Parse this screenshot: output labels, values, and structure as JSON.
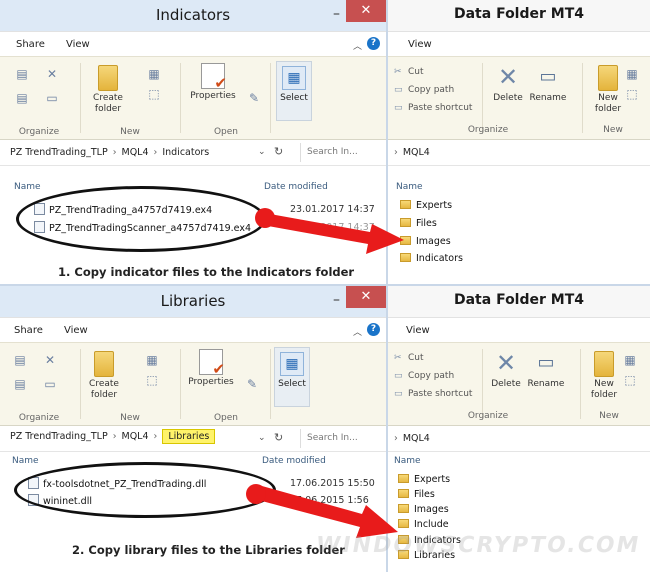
{
  "top_left": {
    "title": "Indicators",
    "tabs": [
      "Share",
      "View"
    ],
    "groups": {
      "organize": "Organize",
      "new": "New",
      "open": "Open"
    },
    "new_folder": "Create\nfolder",
    "properties": "Properties",
    "select": "Select",
    "path": [
      "PZ TrendTrading_TLP",
      "MQL4",
      "Indicators"
    ],
    "search_placeholder": "Search In...",
    "col_name": "Name",
    "col_date": "Date modified",
    "files": [
      {
        "name": "PZ_TrendTrading_a4757d7419.ex4",
        "date": "23.01.2017 14:37"
      },
      {
        "name": "PZ_TrendTradingScanner_a4757d7419.ex4",
        "date": "23.01.2017 14:37"
      }
    ],
    "caption": "1. Copy indicator files to the Indicators folder"
  },
  "top_right": {
    "title": "Data Folder   MT4",
    "tab": "View",
    "cut": "Cut",
    "copy_path": "Copy path",
    "paste_shortcut": "Paste shortcut",
    "delete": "Delete",
    "rename": "Rename",
    "new_folder": "New\nfolder",
    "organize": "Organize",
    "new": "New",
    "path": "MQL4",
    "col_name": "Name",
    "folders": [
      "Experts",
      "Files",
      "Images",
      "Indicators"
    ]
  },
  "bottom_left": {
    "title": "Libraries",
    "tabs": [
      "Share",
      "View"
    ],
    "groups": {
      "organize": "Organize",
      "new": "New",
      "open": "Open"
    },
    "new_folder": "Create\nfolder",
    "properties": "Properties",
    "select": "Select",
    "path": [
      "PZ TrendTrading_TLP",
      "MQL4",
      "Libraries"
    ],
    "search_placeholder": "Search In...",
    "col_name": "Name",
    "col_date": "Date modified",
    "files": [
      {
        "name": "fx-toolsdotnet_PZ_TrendTrading.dll",
        "date": "17.06.2015 15:50"
      },
      {
        "name": "wininet.dll",
        "date": "17.06.2015 1:56"
      }
    ],
    "caption": "2. Copy library files to the Libraries folder"
  },
  "bottom_right": {
    "title": "Data Folder   MT4",
    "tab": "View",
    "cut": "Cut",
    "copy_path": "Copy path",
    "paste_shortcut": "Paste shortcut",
    "delete": "Delete",
    "rename": "Rename",
    "new_folder": "New\nfolder",
    "organize": "Organize",
    "new": "New",
    "path": "MQL4",
    "col_name": "Name",
    "folders": [
      "Experts",
      "Files",
      "Images",
      "Include",
      "Indicators",
      "Libraries"
    ]
  },
  "watermark": "WINDOWSCRYPTO.COM",
  "colors": {
    "title_blue": "#dde9f6",
    "ribbon": "#f8f6ea",
    "close_red": "#c75050",
    "arrow_red": "#e81b1b",
    "highlight": "#fff36a"
  }
}
